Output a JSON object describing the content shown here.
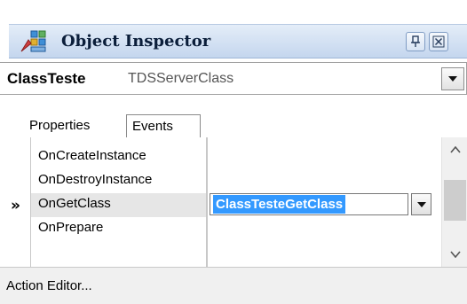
{
  "window": {
    "title": "Object Inspector",
    "icons": {
      "app": "component-palette-icon",
      "pin": "pin-icon",
      "close": "close-icon"
    }
  },
  "selector": {
    "object_name": "ClassTeste",
    "object_class": "TDSServerClass",
    "dropdown_icon": "chevron-down-icon"
  },
  "tabs": [
    {
      "label": "Properties",
      "active": false
    },
    {
      "label": "Events",
      "active": true
    }
  ],
  "events": [
    {
      "name": "OnCreateInstance",
      "value": ""
    },
    {
      "name": "OnDestroyInstance",
      "value": ""
    },
    {
      "name": "OnGetClass",
      "value": "ClassTesteGetClass",
      "selected": true
    },
    {
      "name": "OnPrepare",
      "value": ""
    }
  ],
  "current_row_marker": "»",
  "footer": {
    "action_editor": "Action Editor..."
  },
  "colors": {
    "title_bar": "#c4d6ee",
    "selection": "#3399ff",
    "selected_row": "#e6e6e6",
    "footer": "#f0f0f0"
  }
}
